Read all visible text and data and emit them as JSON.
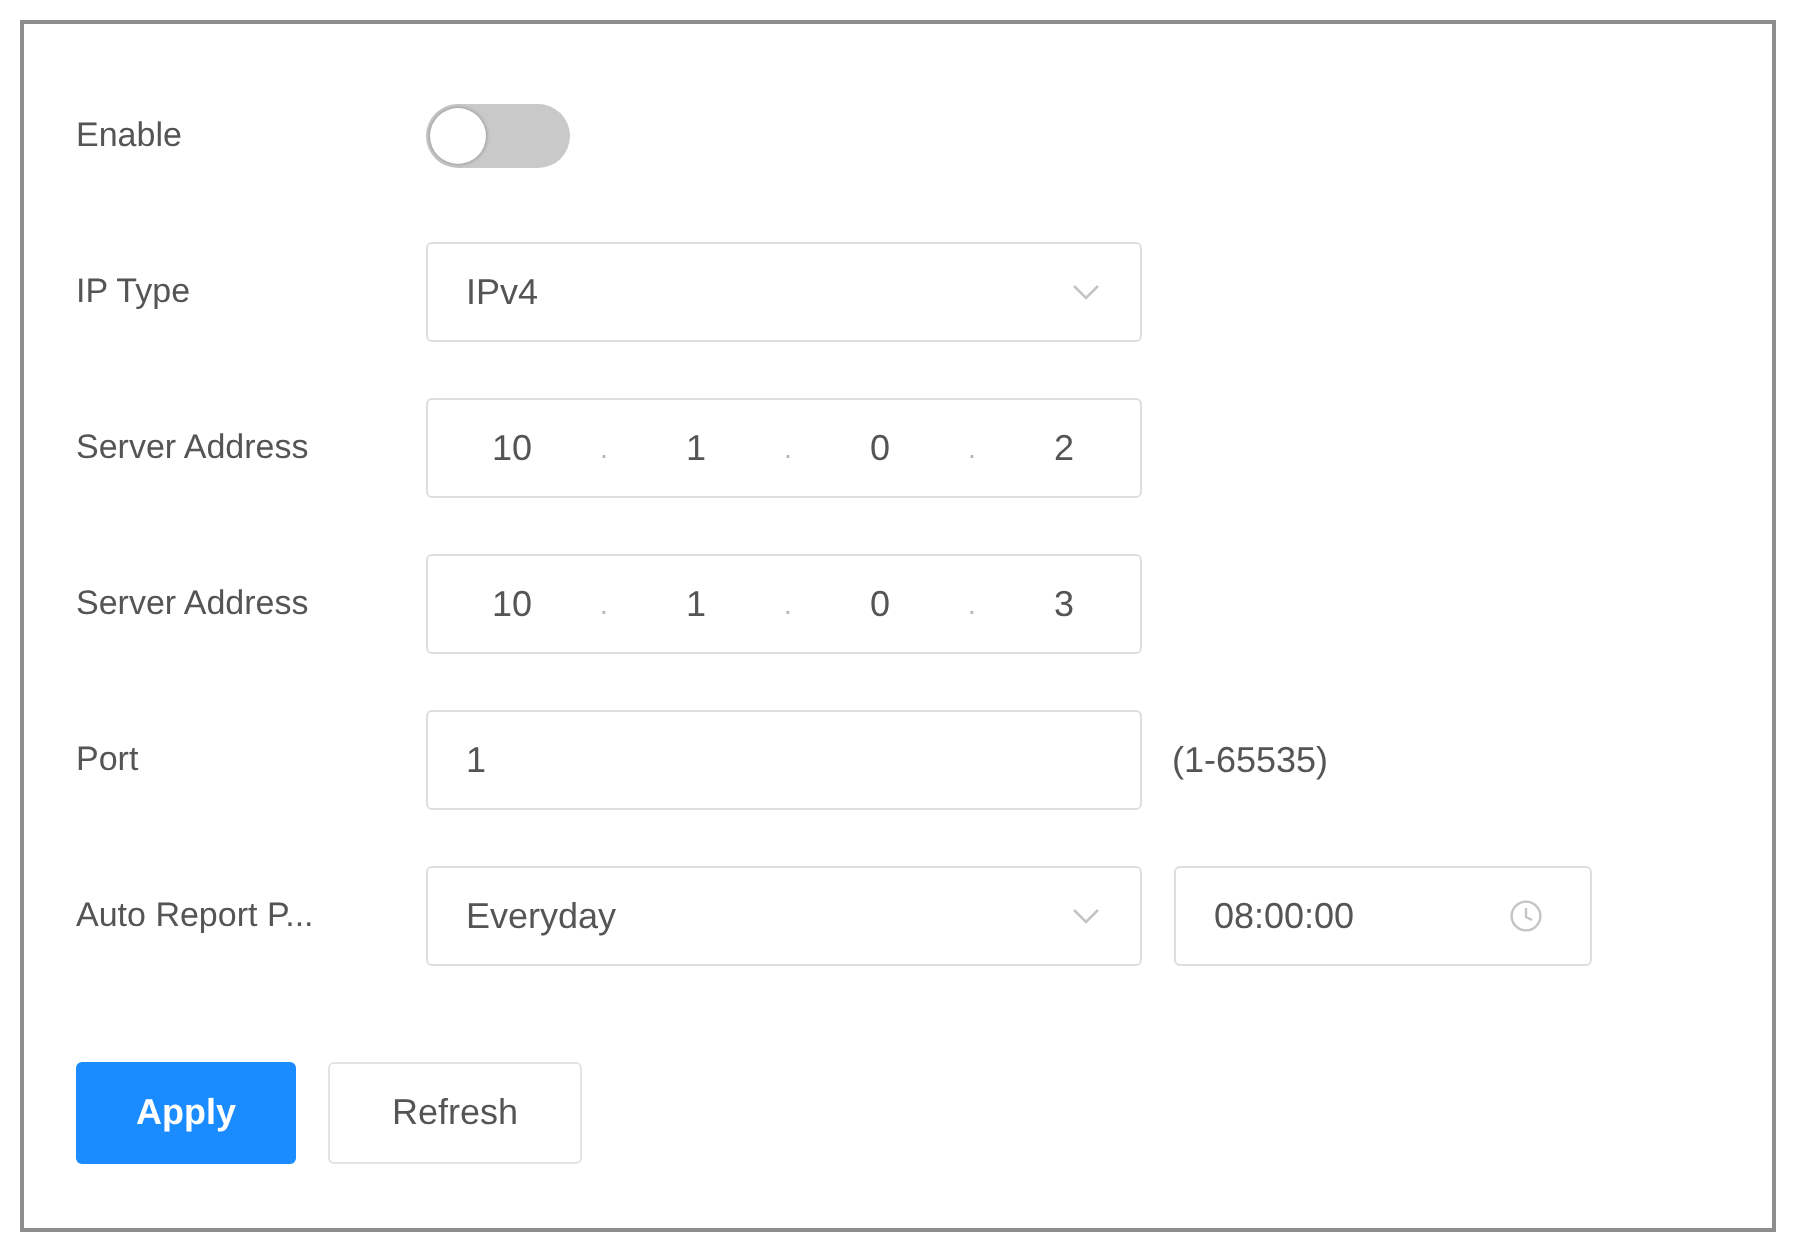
{
  "fields": [
    {
      "kind": "toggle",
      "label": "Enable",
      "on": false
    },
    {
      "kind": "select",
      "label": "IP Type",
      "value": "IPv4"
    },
    {
      "kind": "ip",
      "label": "Server Address",
      "octets": [
        "10",
        "1",
        "0",
        "2"
      ],
      "separator": "."
    },
    {
      "kind": "ip",
      "label": "Server Address",
      "octets": [
        "10",
        "1",
        "0",
        "3"
      ],
      "separator": "."
    },
    {
      "kind": "text",
      "label": "Port",
      "value": "1",
      "hint": "(1-65535)"
    },
    {
      "kind": "select_time",
      "label": "Auto Report P...",
      "value": "Everyday",
      "time": "08:00:00"
    }
  ],
  "buttons": [
    {
      "label": "Apply",
      "kind": "primary"
    },
    {
      "label": "Refresh",
      "kind": "default"
    }
  ]
}
